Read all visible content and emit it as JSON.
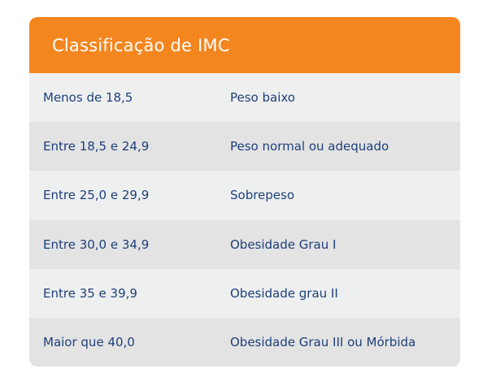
{
  "table": {
    "title": "Classificação de IMC",
    "header_color": "#f4861f",
    "text_color": "#1e3f7a",
    "rows": [
      {
        "range": "Menos de 18,5",
        "classification": "Peso baixo"
      },
      {
        "range": "Entre 18,5 e 24,9",
        "classification": "Peso normal ou adequado"
      },
      {
        "range": "Entre 25,0 e 29,9",
        "classification": "Sobrepeso"
      },
      {
        "range": "Entre 30,0 e 34,9",
        "classification": "Obesidade Grau I"
      },
      {
        "range": "Entre 35 e 39,9",
        "classification": "Obesidade grau II"
      },
      {
        "range": "Maior que 40,0",
        "classification": "Obesidade Grau III ou Mórbida"
      }
    ]
  }
}
